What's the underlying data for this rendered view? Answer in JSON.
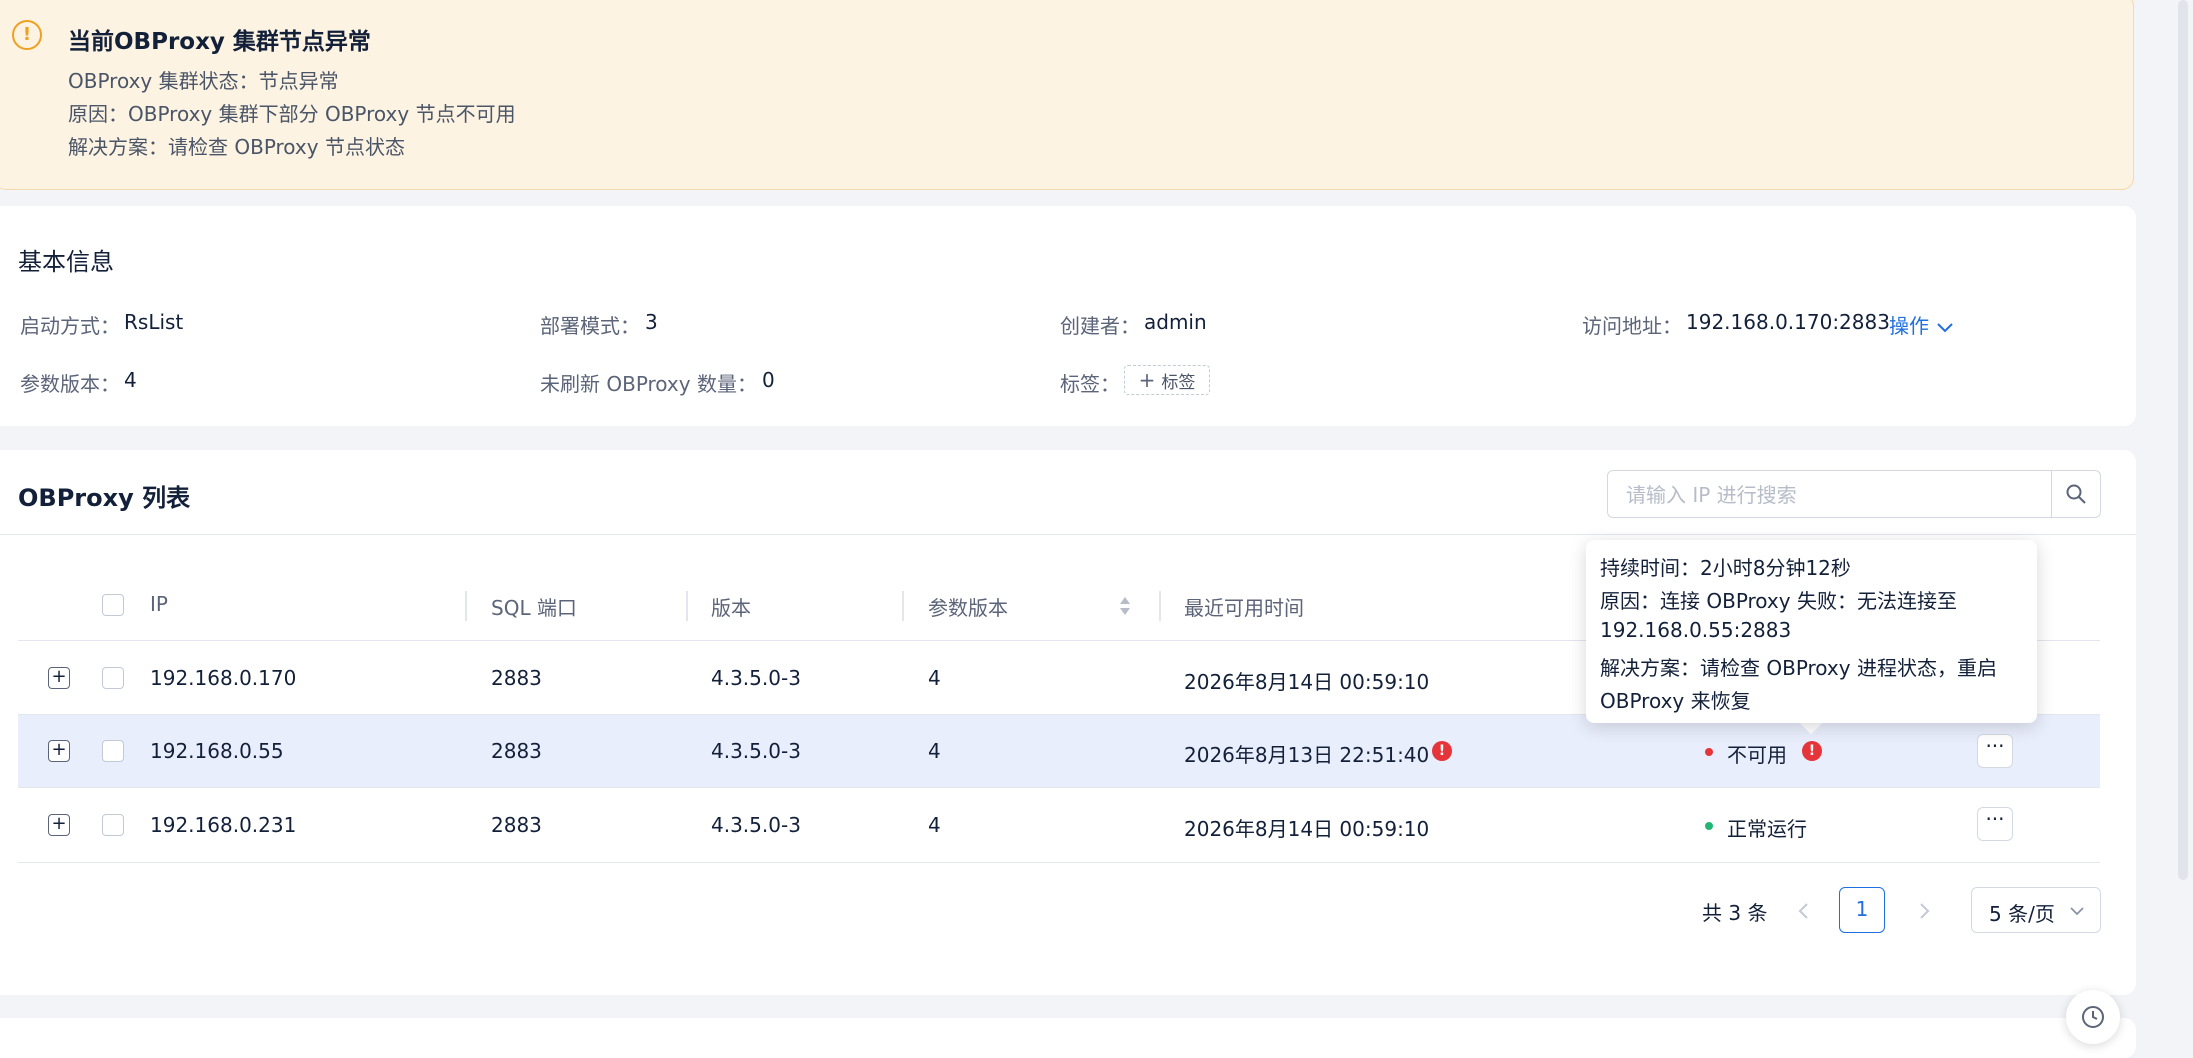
{
  "alert": {
    "title": "当前OBProxy 集群节点异常",
    "status_line": "OBProxy 集群状态：节点异常",
    "reason_line": "原因：OBProxy 集群下部分 OBProxy 节点不可用",
    "solution_line": "解决方案：请检查 OBProxy 节点状态",
    "icon": "exclamation-circle-icon"
  },
  "basic_info": {
    "title": "基本信息",
    "startup_label": "启动方式：",
    "startup_value": "RsList",
    "deploy_label": "部署模式：",
    "deploy_value": "3",
    "creator_label": "创建者：",
    "creator_value": "admin",
    "address_label": "访问地址：",
    "address_value": "192.168.0.170:2883",
    "operation_link": "操作",
    "param_version_label": "参数版本：",
    "param_version_value": "4",
    "unrefreshed_label": "未刷新 OBProxy 数量：",
    "unrefreshed_value": "0",
    "tags_label": "标签：",
    "add_tag_button": "标签"
  },
  "obproxy_list": {
    "title": "OBProxy 列表",
    "search_placeholder": "请输入 IP 进行搜索",
    "columns": [
      "IP",
      "SQL 端口",
      "版本",
      "参数版本",
      "最近可用时间"
    ],
    "rows": [
      {
        "ip": "192.168.0.170",
        "port": "2883",
        "version": "4.3.5.0-3",
        "param_version": "4",
        "last_available": "2026年8月14日 00:59:10",
        "status": "",
        "error": false
      },
      {
        "ip": "192.168.0.55",
        "port": "2883",
        "version": "4.3.5.0-3",
        "param_version": "4",
        "last_available": "2026年8月13日 22:51:40",
        "status": "不可用",
        "error": true
      },
      {
        "ip": "192.168.0.231",
        "port": "2883",
        "version": "4.3.5.0-3",
        "param_version": "4",
        "last_available": "2026年8月14日 00:59:10",
        "status": "正常运行",
        "error": false
      }
    ],
    "more_label": "···"
  },
  "tooltip": {
    "duration": "持续时间：2小时8分钟12秒",
    "reason_1": "原因：连接 OBProxy 失败：无法连接至",
    "reason_2": "192.168.0.55:2883",
    "solution_1": "解决方案：请检查 OBProxy 进程状态，重启",
    "solution_2": "OBProxy 来恢复"
  },
  "pagination": {
    "total": "共 3 条",
    "current_page": "1",
    "page_size": "5 条/页"
  },
  "colors": {
    "accent": "#1f6fe0",
    "warning": "#f0a020",
    "error": "#e5353b",
    "success": "#22b573",
    "highlight_row": "#e9eefc"
  }
}
